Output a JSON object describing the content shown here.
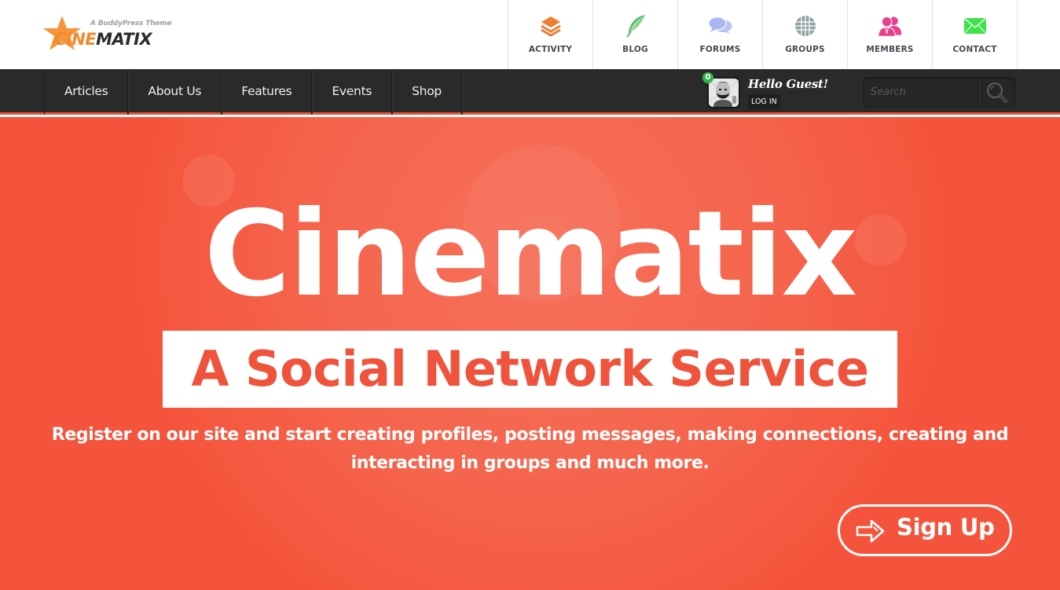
{
  "brand": {
    "tagline": "A BuddyPress Theme",
    "name_accent": "CINE",
    "name_rest": "MATIX",
    "accent_color": "#f18a2c"
  },
  "icon_nav": [
    {
      "label": "ACTIVITY",
      "icon": "layers-icon",
      "color": "#ef7d32"
    },
    {
      "label": "BLOG",
      "icon": "feather-icon",
      "color": "#5fbf6a"
    },
    {
      "label": "FORUMS",
      "icon": "chat-bubbles-icon",
      "color": "#aab8f5"
    },
    {
      "label": "GROUPS",
      "icon": "globe-icon",
      "color": "#8fa3a3"
    },
    {
      "label": "MEMBERS",
      "icon": "users-icon",
      "color": "#ea3f8c"
    },
    {
      "label": "CONTACT",
      "icon": "envelope-icon",
      "color": "#3ee24a"
    }
  ],
  "menu": {
    "items": [
      "Articles",
      "About Us",
      "Features",
      "Events",
      "Shop"
    ]
  },
  "user": {
    "notification_count": "0",
    "greeting": "Hello Guest!",
    "login_label": "LOG IN"
  },
  "search": {
    "placeholder": "Search",
    "value": ""
  },
  "hero": {
    "title": "Cinematix",
    "subtitle": "A Social Network Service",
    "description": "Register on our site and start creating profiles, posting messages, making connections, creating and interacting in groups and much more.",
    "cta_label": "Sign Up",
    "background_color": "#f5543c"
  }
}
